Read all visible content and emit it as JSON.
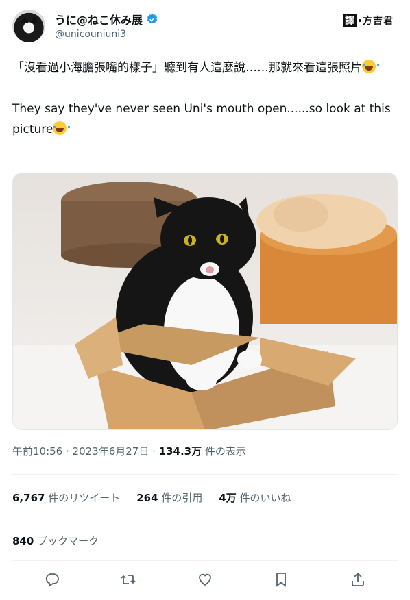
{
  "author": {
    "display_name": "うに@ねこ休み展",
    "handle": "@unicouniuni3",
    "verified": true
  },
  "watermark": {
    "box_char": "譯",
    "text": "方吉君"
  },
  "tweet": {
    "line1": "「沒看過小海膽張嘴的樣子」聽到有人這麼說……那就來看這張照片",
    "line2": "They say they've never seen Uni's mouth open......so look at this picture",
    "emoji": "face-with-tears-of-joy"
  },
  "meta": {
    "time": "午前10:56",
    "sep1": " · ",
    "date": "2023年6月27日",
    "sep2": " · ",
    "views_count": "134.3万",
    "views_label": " 件の表示"
  },
  "stats": {
    "retweets_count": "6,767",
    "retweets_label": " 件のリツイート",
    "quotes_count": "264",
    "quotes_label": " 件の引用",
    "likes_count": "4万",
    "likes_label": " 件のいいね"
  },
  "bookmarks": {
    "count": "840",
    "label": " ブックマーク"
  },
  "actions": [
    "reply-icon",
    "retweet-icon",
    "like-icon",
    "bookmark-icon",
    "share-icon"
  ],
  "colors": {
    "text": "#0f1419",
    "secondary": "#536471",
    "verified": "#1d9bf0",
    "divider": "#eff3f4"
  }
}
